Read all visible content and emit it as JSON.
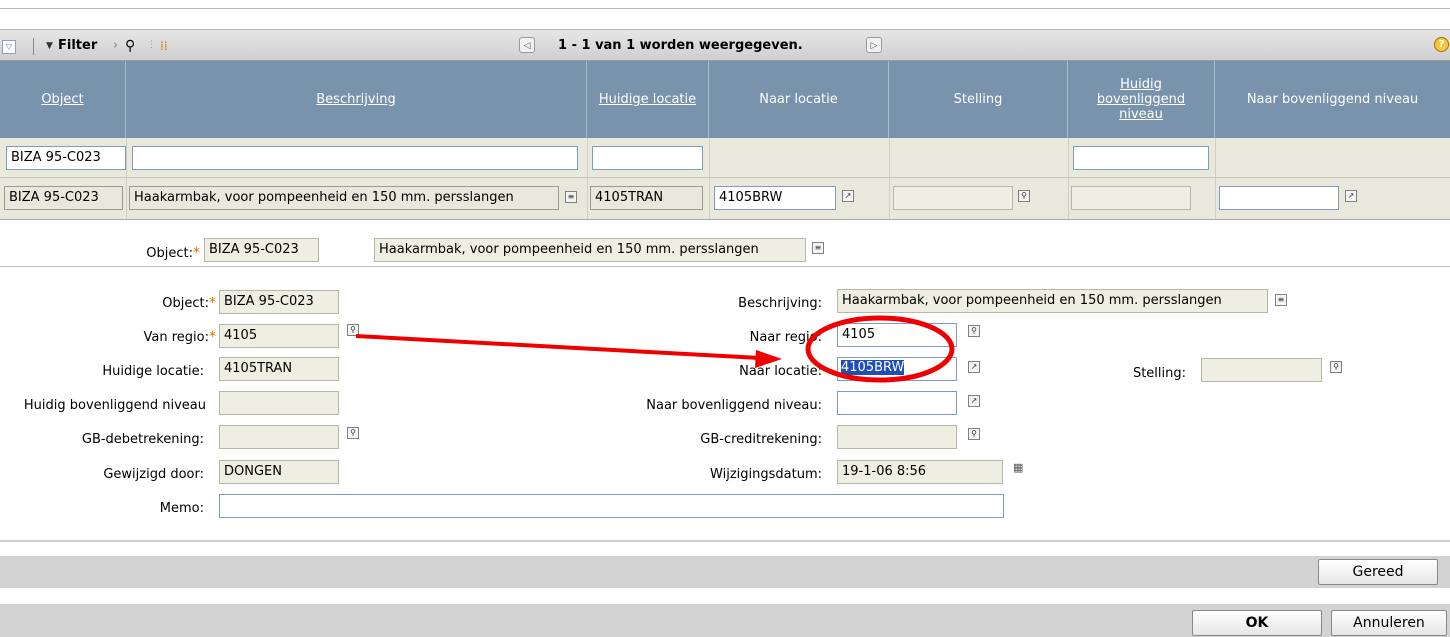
{
  "toolbar": {
    "filter_label": "Filter",
    "record_status": "1 - 1 van 1 worden weergegeven.",
    "help_label": "?"
  },
  "grid": {
    "columns": [
      "Object",
      "Beschrijving",
      "Huidige locatie",
      "Naar locatie",
      "Stelling",
      "Huidig bovenliggend niveau",
      "Naar bovenliggend niveau"
    ],
    "filter_row": {
      "object": "BIZA 95-C023"
    },
    "row": {
      "object": "BIZA 95-C023",
      "beschrijving": "Haakarmbak, voor pompeenheid en 150 mm. persslangen",
      "huidige_locatie": "4105TRAN",
      "naar_locatie": "4105BRW"
    }
  },
  "header_form": {
    "object_label": "Object:",
    "object_value": "BIZA 95-C023",
    "description_value": "Haakarmbak, voor pompeenheid en 150 mm. persslangen"
  },
  "detail": {
    "object_label": "Object:",
    "object_value": "BIZA 95-C023",
    "van_regio_label": "Van regio:",
    "van_regio_value": "4105",
    "huidige_locatie_label": "Huidige locatie:",
    "huidige_locatie_value": "4105TRAN",
    "huidig_boven_label": "Huidig bovenliggend niveau",
    "gb_debet_label": "GB-debetrekening:",
    "gewijzigd_label": "Gewijzigd door:",
    "gewijzigd_value": "DONGEN",
    "memo_label": "Memo:",
    "beschrijving_label": "Beschrijving:",
    "beschrijving_value": "Haakarmbak, voor pompeenheid en 150 mm. persslangen",
    "naar_regio_label": "Naar regio:",
    "naar_regio_value": "4105",
    "naar_locatie_label": "Naar locatie:",
    "naar_locatie_value": "4105BRW",
    "stelling_label": "Stelling:",
    "naar_boven_label": "Naar bovenliggend niveau:",
    "gb_credit_label": "GB-creditrekening:",
    "wijzigingsdatum_label": "Wijzigingsdatum:",
    "wijzigingsdatum_value": "19-1-06 8:56"
  },
  "buttons": {
    "gereed": "Gereed",
    "ok": "OK",
    "annuleren": "Annuleren"
  },
  "colors": {
    "header_bg": "#7a93ad",
    "row_bg": "#e9e8dc",
    "annotation_red": "#ee0000"
  }
}
